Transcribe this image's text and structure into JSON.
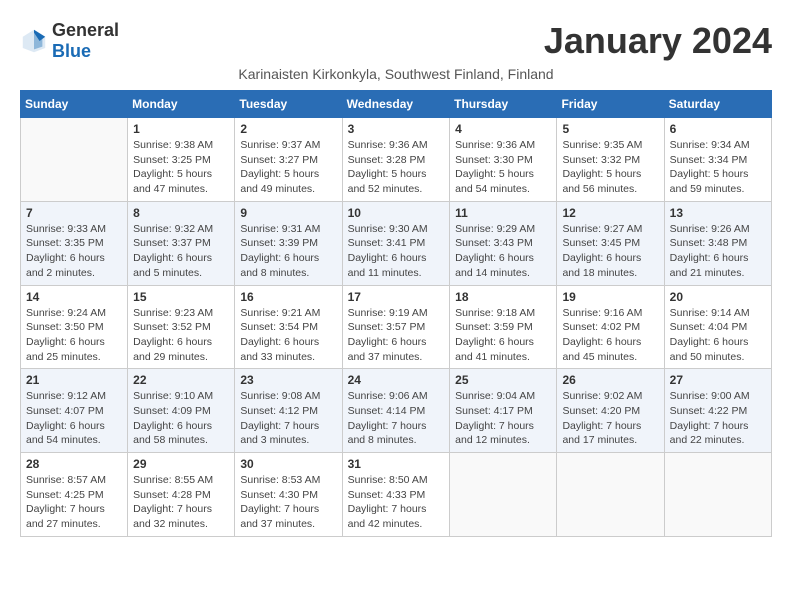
{
  "logo": {
    "general": "General",
    "blue": "Blue"
  },
  "header": {
    "month_title": "January 2024",
    "subtitle": "Karinaisten Kirkonkyla, Southwest Finland, Finland"
  },
  "days_of_week": [
    "Sunday",
    "Monday",
    "Tuesday",
    "Wednesday",
    "Thursday",
    "Friday",
    "Saturday"
  ],
  "weeks": [
    [
      {
        "day": "",
        "info": ""
      },
      {
        "day": "1",
        "info": "Sunrise: 9:38 AM\nSunset: 3:25 PM\nDaylight: 5 hours\nand 47 minutes."
      },
      {
        "day": "2",
        "info": "Sunrise: 9:37 AM\nSunset: 3:27 PM\nDaylight: 5 hours\nand 49 minutes."
      },
      {
        "day": "3",
        "info": "Sunrise: 9:36 AM\nSunset: 3:28 PM\nDaylight: 5 hours\nand 52 minutes."
      },
      {
        "day": "4",
        "info": "Sunrise: 9:36 AM\nSunset: 3:30 PM\nDaylight: 5 hours\nand 54 minutes."
      },
      {
        "day": "5",
        "info": "Sunrise: 9:35 AM\nSunset: 3:32 PM\nDaylight: 5 hours\nand 56 minutes."
      },
      {
        "day": "6",
        "info": "Sunrise: 9:34 AM\nSunset: 3:34 PM\nDaylight: 5 hours\nand 59 minutes."
      }
    ],
    [
      {
        "day": "7",
        "info": "Sunrise: 9:33 AM\nSunset: 3:35 PM\nDaylight: 6 hours\nand 2 minutes."
      },
      {
        "day": "8",
        "info": "Sunrise: 9:32 AM\nSunset: 3:37 PM\nDaylight: 6 hours\nand 5 minutes."
      },
      {
        "day": "9",
        "info": "Sunrise: 9:31 AM\nSunset: 3:39 PM\nDaylight: 6 hours\nand 8 minutes."
      },
      {
        "day": "10",
        "info": "Sunrise: 9:30 AM\nSunset: 3:41 PM\nDaylight: 6 hours\nand 11 minutes."
      },
      {
        "day": "11",
        "info": "Sunrise: 9:29 AM\nSunset: 3:43 PM\nDaylight: 6 hours\nand 14 minutes."
      },
      {
        "day": "12",
        "info": "Sunrise: 9:27 AM\nSunset: 3:45 PM\nDaylight: 6 hours\nand 18 minutes."
      },
      {
        "day": "13",
        "info": "Sunrise: 9:26 AM\nSunset: 3:48 PM\nDaylight: 6 hours\nand 21 minutes."
      }
    ],
    [
      {
        "day": "14",
        "info": "Sunrise: 9:24 AM\nSunset: 3:50 PM\nDaylight: 6 hours\nand 25 minutes."
      },
      {
        "day": "15",
        "info": "Sunrise: 9:23 AM\nSunset: 3:52 PM\nDaylight: 6 hours\nand 29 minutes."
      },
      {
        "day": "16",
        "info": "Sunrise: 9:21 AM\nSunset: 3:54 PM\nDaylight: 6 hours\nand 33 minutes."
      },
      {
        "day": "17",
        "info": "Sunrise: 9:19 AM\nSunset: 3:57 PM\nDaylight: 6 hours\nand 37 minutes."
      },
      {
        "day": "18",
        "info": "Sunrise: 9:18 AM\nSunset: 3:59 PM\nDaylight: 6 hours\nand 41 minutes."
      },
      {
        "day": "19",
        "info": "Sunrise: 9:16 AM\nSunset: 4:02 PM\nDaylight: 6 hours\nand 45 minutes."
      },
      {
        "day": "20",
        "info": "Sunrise: 9:14 AM\nSunset: 4:04 PM\nDaylight: 6 hours\nand 50 minutes."
      }
    ],
    [
      {
        "day": "21",
        "info": "Sunrise: 9:12 AM\nSunset: 4:07 PM\nDaylight: 6 hours\nand 54 minutes."
      },
      {
        "day": "22",
        "info": "Sunrise: 9:10 AM\nSunset: 4:09 PM\nDaylight: 6 hours\nand 58 minutes."
      },
      {
        "day": "23",
        "info": "Sunrise: 9:08 AM\nSunset: 4:12 PM\nDaylight: 7 hours\nand 3 minutes."
      },
      {
        "day": "24",
        "info": "Sunrise: 9:06 AM\nSunset: 4:14 PM\nDaylight: 7 hours\nand 8 minutes."
      },
      {
        "day": "25",
        "info": "Sunrise: 9:04 AM\nSunset: 4:17 PM\nDaylight: 7 hours\nand 12 minutes."
      },
      {
        "day": "26",
        "info": "Sunrise: 9:02 AM\nSunset: 4:20 PM\nDaylight: 7 hours\nand 17 minutes."
      },
      {
        "day": "27",
        "info": "Sunrise: 9:00 AM\nSunset: 4:22 PM\nDaylight: 7 hours\nand 22 minutes."
      }
    ],
    [
      {
        "day": "28",
        "info": "Sunrise: 8:57 AM\nSunset: 4:25 PM\nDaylight: 7 hours\nand 27 minutes."
      },
      {
        "day": "29",
        "info": "Sunrise: 8:55 AM\nSunset: 4:28 PM\nDaylight: 7 hours\nand 32 minutes."
      },
      {
        "day": "30",
        "info": "Sunrise: 8:53 AM\nSunset: 4:30 PM\nDaylight: 7 hours\nand 37 minutes."
      },
      {
        "day": "31",
        "info": "Sunrise: 8:50 AM\nSunset: 4:33 PM\nDaylight: 7 hours\nand 42 minutes."
      },
      {
        "day": "",
        "info": ""
      },
      {
        "day": "",
        "info": ""
      },
      {
        "day": "",
        "info": ""
      }
    ]
  ]
}
